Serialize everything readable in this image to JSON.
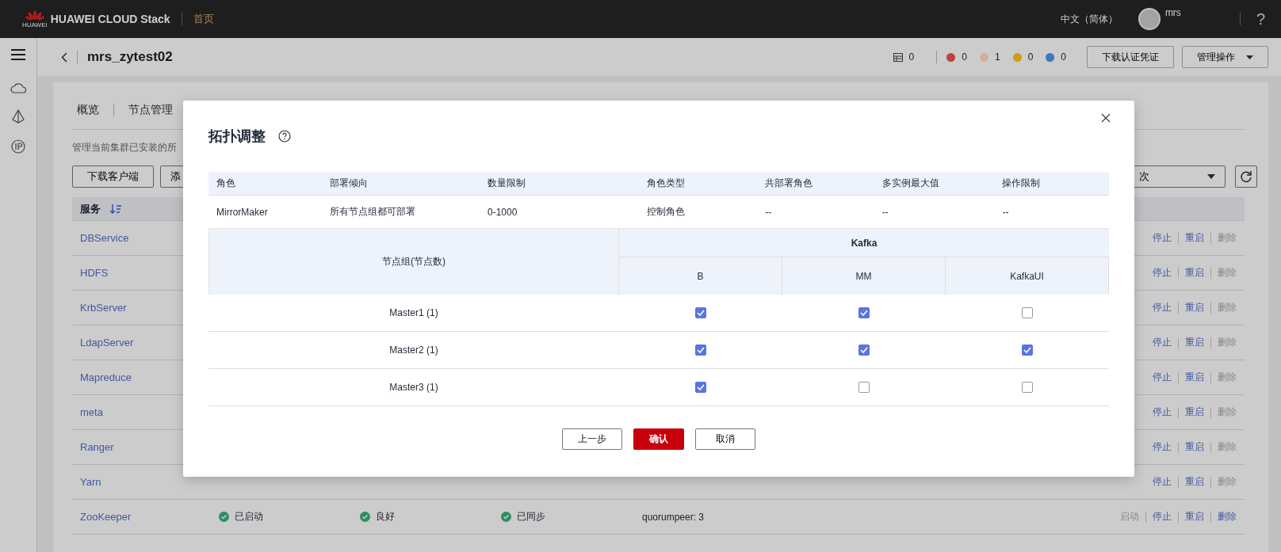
{
  "topbar": {
    "logo_text": "HUAWEI",
    "brand": "HUAWEI CLOUD Stack",
    "home": "首页",
    "language": "中文（简体）",
    "user": "mrs",
    "help": "?"
  },
  "header": {
    "title": "mrs_zytest02",
    "alarms": [
      {
        "kind": "total",
        "count": "0"
      },
      {
        "kind": "dot",
        "color": "#c04040",
        "count": "0"
      },
      {
        "kind": "dot",
        "color": "#d4ae94",
        "count": "1"
      },
      {
        "kind": "dot",
        "color": "#c8a010",
        "count": "0"
      },
      {
        "kind": "dot",
        "color": "#3a78c0",
        "count": "0"
      }
    ],
    "buttons": [
      {
        "label": "下载认证凭证",
        "kind": "plain"
      },
      {
        "label": "管理操作",
        "kind": "menu"
      }
    ]
  },
  "page": {
    "tabs": [
      "概览",
      "节点管理"
    ],
    "description": "管理当前集群已安装的所",
    "buttons": [
      "下载客户端",
      "添"
    ],
    "filter": "次",
    "service_header": "服务",
    "rows": [
      {
        "name": "DBService",
        "actions": [
          {
            "label": "停止",
            "disabled": false
          },
          {
            "label": "重启",
            "disabled": false
          },
          {
            "label": "删除",
            "disabled": true
          }
        ]
      },
      {
        "name": "HDFS",
        "actions": [
          {
            "label": "停止",
            "disabled": false
          },
          {
            "label": "重启",
            "disabled": false
          },
          {
            "label": "删除",
            "disabled": true
          }
        ]
      },
      {
        "name": "KrbServer",
        "actions": [
          {
            "label": "停止",
            "disabled": false
          },
          {
            "label": "重启",
            "disabled": false
          },
          {
            "label": "删除",
            "disabled": true
          }
        ]
      },
      {
        "name": "LdapServer",
        "actions": [
          {
            "label": "停止",
            "disabled": false
          },
          {
            "label": "重启",
            "disabled": false
          },
          {
            "label": "删除",
            "disabled": true
          }
        ]
      },
      {
        "name": "Mapreduce",
        "actions": [
          {
            "label": "停止",
            "disabled": false
          },
          {
            "label": "重启",
            "disabled": false
          },
          {
            "label": "删除",
            "disabled": true
          }
        ]
      },
      {
        "name": "meta",
        "actions": [
          {
            "label": "停止",
            "disabled": false
          },
          {
            "label": "重启",
            "disabled": false
          },
          {
            "label": "删除",
            "disabled": true
          }
        ]
      },
      {
        "name": "Ranger",
        "actions": [
          {
            "label": "停止",
            "disabled": false
          },
          {
            "label": "重启",
            "disabled": false
          },
          {
            "label": "删除",
            "disabled": true
          }
        ]
      },
      {
        "name": "Yarn",
        "actions": [
          {
            "label": "停止",
            "disabled": false
          },
          {
            "label": "重启",
            "disabled": false
          },
          {
            "label": "删除",
            "disabled": true
          }
        ]
      },
      {
        "name": "ZooKeeper",
        "status": "已启动",
        "health": "良好",
        "config": "已同步",
        "roles": "quorumpeer: 3",
        "actions": [
          {
            "label": "启动",
            "disabled": true
          },
          {
            "label": "停止",
            "disabled": false
          },
          {
            "label": "重启",
            "disabled": false
          },
          {
            "label": "删除",
            "disabled": false
          }
        ]
      }
    ]
  },
  "dialog": {
    "title": "拓扑调整",
    "columns": [
      "角色",
      "部署倾向",
      "数量限制",
      "角色类型",
      "共部署角色",
      "多实例最大值",
      "操作限制"
    ],
    "row": [
      "MirrorMaker",
      "所有节点组都可部署",
      "0-1000",
      "控制角色",
      "--",
      "--",
      "--"
    ],
    "group_header": "节点组(节点数)",
    "service": "Kafka",
    "roles": [
      "B",
      "MM",
      "KafkaUI"
    ],
    "groups": [
      {
        "name": "Master1 (1)",
        "checks": [
          true,
          true,
          false
        ]
      },
      {
        "name": "Master2 (1)",
        "checks": [
          true,
          true,
          true
        ]
      },
      {
        "name": "Master3 (1)",
        "checks": [
          true,
          false,
          false
        ]
      }
    ],
    "buttons": [
      {
        "label": "上一步",
        "kind": "default"
      },
      {
        "label": "确认",
        "kind": "primary"
      },
      {
        "label": "取消",
        "kind": "default"
      }
    ]
  }
}
